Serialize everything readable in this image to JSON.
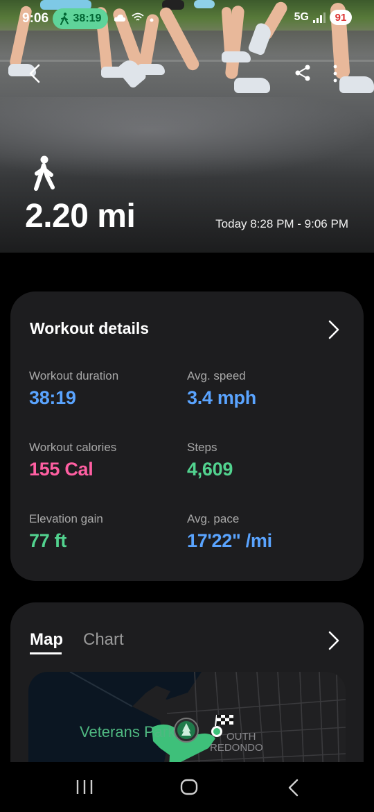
{
  "status_bar": {
    "time": "9:06",
    "active_timer": "38:19",
    "network": "5G",
    "battery": "91"
  },
  "header": {
    "activity_icon": "walking-person-icon",
    "distance": "2.20 mi",
    "time_range": "Today 8:28 PM - 9:06 PM"
  },
  "workout_details": {
    "title": "Workout details",
    "metrics": [
      {
        "label": "Workout duration",
        "value": "38:19",
        "color": "#5aa4ff"
      },
      {
        "label": "Avg. speed",
        "value": "3.4 mph",
        "color": "#5aa4ff"
      },
      {
        "label": "Workout calories",
        "value": "155 Cal",
        "color": "#ff5fa2"
      },
      {
        "label": "Steps",
        "value": "4,609",
        "color": "#52d38f"
      },
      {
        "label": "Elevation gain",
        "value": "77 ft",
        "color": "#52d38f"
      },
      {
        "label": "Avg. pace",
        "value": "17'22\" /mi",
        "color": "#5aa4ff"
      }
    ]
  },
  "map_card": {
    "tabs": [
      {
        "label": "Map",
        "selected": true
      },
      {
        "label": "Chart",
        "selected": false
      }
    ],
    "map_labels": {
      "park": "Veterans Park",
      "area_line1": "OUTH",
      "area_line2": "REDONDO"
    }
  },
  "colors": {
    "accent_green": "#52d38f",
    "card_bg": "#1d1d1f",
    "pill_green": "#5fd49a"
  }
}
